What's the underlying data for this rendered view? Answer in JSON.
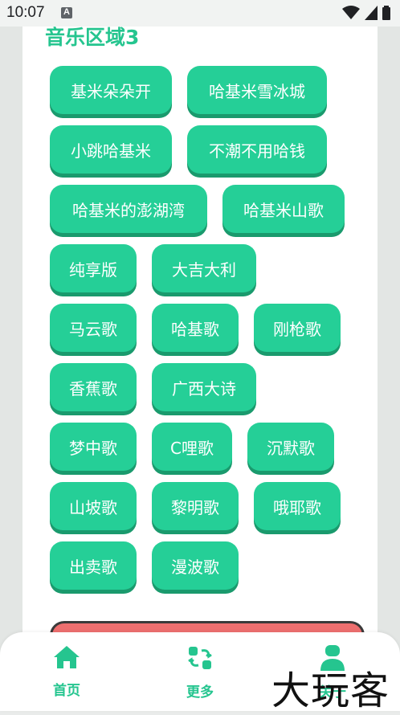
{
  "status_bar": {
    "time": "10:07",
    "notif_letter": "A"
  },
  "section": {
    "title": "音乐区域3"
  },
  "chips": [
    {
      "label": "基米朵朵开"
    },
    {
      "label": "哈基米雪冰城"
    },
    {
      "label": "小跳哈基米"
    },
    {
      "label": "不潮不用哈钱"
    },
    {
      "label": "哈基米的澎湖湾"
    },
    {
      "label": "哈基米山歌"
    },
    {
      "label": "纯享版"
    },
    {
      "label": "大吉大利"
    },
    {
      "label": "马云歌"
    },
    {
      "label": "哈基歌"
    },
    {
      "label": "刚枪歌"
    },
    {
      "label": "香蕉歌"
    },
    {
      "label": "广西大诗"
    },
    {
      "label": "梦中歌"
    },
    {
      "label": "C哩歌"
    },
    {
      "label": "沉默歌"
    },
    {
      "label": "山坡歌"
    },
    {
      "label": "黎明歌"
    },
    {
      "label": "哦耶歌"
    },
    {
      "label": "出卖歌"
    },
    {
      "label": "漫波歌"
    }
  ],
  "bottom_nav": {
    "home_label": "首页",
    "more_label": "更多",
    "about_label": "关于"
  },
  "watermark": "大玩客",
  "colors": {
    "accent": "#25c58f",
    "chip": "#25cf97",
    "alert": "#ee6f6f"
  }
}
